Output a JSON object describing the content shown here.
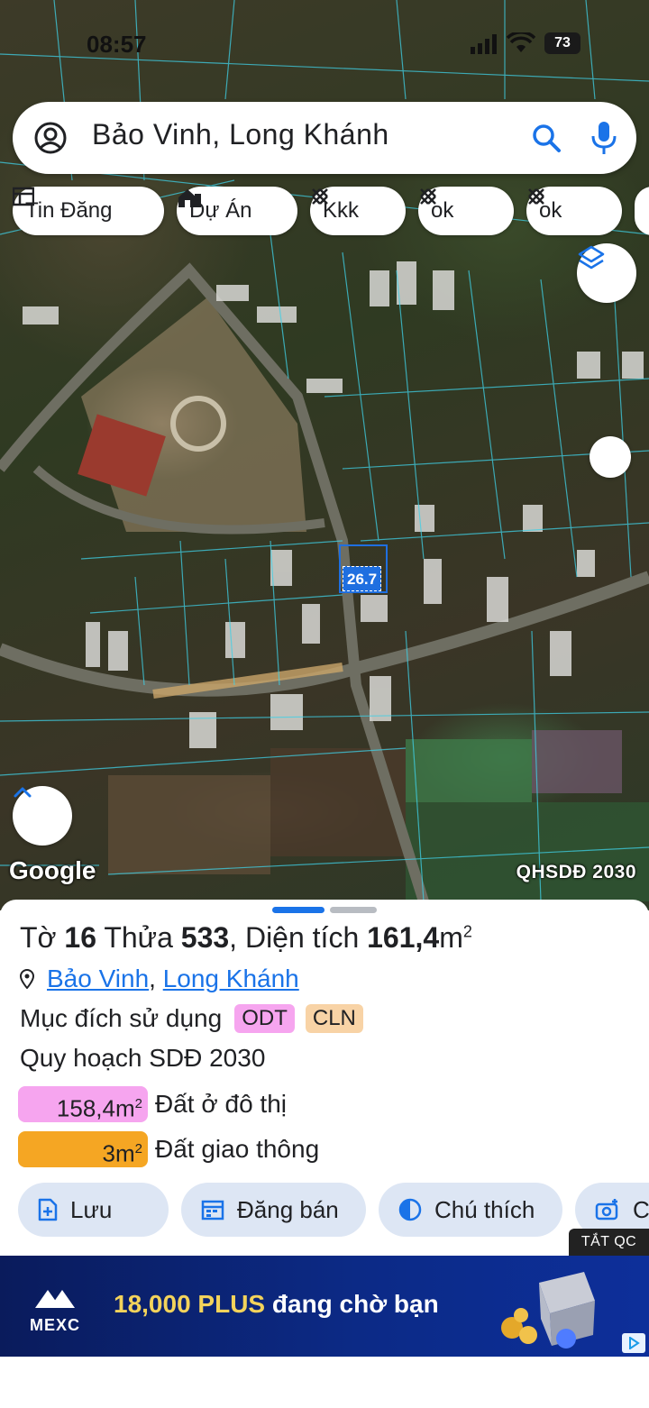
{
  "status_bar": {
    "time": "08:57",
    "battery": "73"
  },
  "search": {
    "query": "Bảo Vinh, Long Khánh"
  },
  "chips": [
    {
      "label": "Tin Đăng",
      "icon": "newspaper-icon"
    },
    {
      "label": "Dự Án",
      "icon": "buildings-icon"
    },
    {
      "label": "Kkk",
      "icon": "hatch-icon"
    },
    {
      "label": "ok",
      "icon": "hatch-icon"
    },
    {
      "label": "ok",
      "icon": "hatch-icon"
    }
  ],
  "map": {
    "watermark": "Google",
    "plan_layer": "QHSDĐ 2030",
    "parcel_label": "26.7"
  },
  "parcel": {
    "title_prefix": "Tờ",
    "sheet_no": "16",
    "plot_word": "Thửa",
    "plot_no": "533",
    "area_word": ", Diện tích",
    "area_value": "161,4",
    "area_unit": "m",
    "area_exp": "2",
    "ward": "Bảo Vinh",
    "separator": ",",
    "city": "Long Khánh",
    "purpose_label": "Mục đích sử dụng",
    "purpose_codes": [
      "ODT",
      "CLN"
    ],
    "plan_title": "Quy hoạch SDĐ 2030",
    "plan_rows": [
      {
        "amount": "158,4m",
        "exp": "2",
        "label": "Đất ở đô thị",
        "color": "#f6a5ef"
      },
      {
        "amount": "3m",
        "exp": "2",
        "label": "Đất giao thông",
        "color": "#f5a623"
      }
    ]
  },
  "actions": [
    {
      "label": "Lưu",
      "icon": "add-document-icon"
    },
    {
      "label": "Đăng bán",
      "icon": "calendar-icon"
    },
    {
      "label": "Chú thích",
      "icon": "contrast-icon"
    },
    {
      "label": "C",
      "icon": "camera-add-icon"
    }
  ],
  "ad": {
    "close_label": "TẮT QC",
    "brand": "MEXC",
    "headline_gold": "18,000 PLUS",
    "headline_rest": " đang chờ bạn"
  },
  "colors": {
    "accent": "#1a73e8",
    "odt": "#f6a5ef",
    "cln": "#f8d3a6",
    "transport": "#f5a623",
    "action_bg": "#dde6f4"
  }
}
